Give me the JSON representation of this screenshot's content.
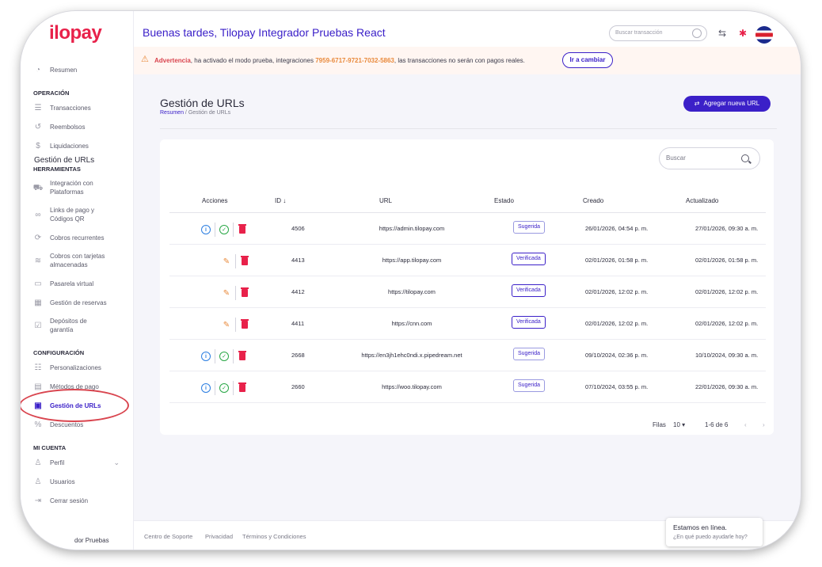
{
  "brand": {
    "logo_text": "tilopay",
    "accent": "#3b20c8",
    "brand_red": "#e8214a"
  },
  "header": {
    "greeting": "Buenas tardes, Tilopay Integrador Pruebas React",
    "search_placeholder": "Buscar transacción",
    "icons": [
      "swap-icon",
      "sparkle-icon",
      "flag-icon"
    ]
  },
  "warning": {
    "label": "Advertencia",
    "text_before": ", ha activado el modo prueba, integraciones ",
    "code": "7959-6717-9721-7032-5863",
    "text_after": ", las transacciones no serán con pagos reales.",
    "button": "Ir a cambiar"
  },
  "sidebar": {
    "top_item": "Resumen",
    "sections": [
      {
        "title": "OPERACIÓN",
        "items": [
          "Transacciones",
          "Reembolsos",
          "Liquidaciones"
        ]
      },
      {
        "title": "HERRAMIENTAS",
        "items": [
          "Integración con Plataformas",
          "Links de pago y Códigos QR",
          "Cobros recurrentes",
          "Cobros con tarjetas almacenadas",
          "Pasarela virtual",
          "Gestión de reservas",
          "Depósitos de garantía"
        ]
      },
      {
        "title": "CONFIGURACIÓN",
        "items": [
          "Personalizaciones",
          "Métodos de pago",
          "Gestión de URLs",
          "Descuentos"
        ]
      },
      {
        "title": "MI CUENTA",
        "items": [
          "Perfil",
          "Usuarios",
          "Cerrar sesión"
        ]
      }
    ],
    "bottom_text": "dor Pruebas"
  },
  "page": {
    "title": "Gestión de URLs",
    "breadcrumb_home": "Resumen",
    "breadcrumb_sep": "/",
    "breadcrumb_current": "Gestión de URLs",
    "add_button": "Agregar nueva URL"
  },
  "card": {
    "title": "Gestión de URLs",
    "search_placeholder": "Buscar",
    "columns": [
      "Acciones",
      "ID ↓",
      "URL",
      "Estado",
      "Creado",
      "Actualizado"
    ],
    "rows": [
      {
        "id": "4506",
        "url": "https://admin.tilopay.com",
        "status": "Sugerida",
        "created": "26/01/2026, 04:54 p. m.",
        "updated": "27/01/2026, 09:30 a. m.",
        "actions": "suggested"
      },
      {
        "id": "4413",
        "url": "https://app.tilopay.com",
        "status": "Verificada",
        "created": "02/01/2026, 01:58 p. m.",
        "updated": "02/01/2026, 01:58 p. m.",
        "actions": "verified"
      },
      {
        "id": "4412",
        "url": "https://tilopay.com",
        "status": "Verificada",
        "created": "02/01/2026, 12:02 p. m.",
        "updated": "02/01/2026, 12:02 p. m.",
        "actions": "verified"
      },
      {
        "id": "4411",
        "url": "https://cnn.com",
        "status": "Verificada",
        "created": "02/01/2026, 12:02 p. m.",
        "updated": "02/01/2026, 12:02 p. m.",
        "actions": "verified"
      },
      {
        "id": "2668",
        "url": "https://en3jh1ehc0ndi.x.pipedream.net",
        "status": "Sugerida",
        "created": "09/10/2024, 02:36 p. m.",
        "updated": "10/10/2024, 09:30 a. m.",
        "actions": "suggested"
      },
      {
        "id": "2660",
        "url": "https://woo.tilopay.com",
        "status": "Sugerida",
        "created": "07/10/2024, 03:55 p. m.",
        "updated": "22/01/2026, 09:30 a. m.",
        "actions": "suggested"
      }
    ],
    "pager": {
      "rows_label": "Filas",
      "rows_value": "10",
      "range": "1-6 de 6"
    }
  },
  "footer": {
    "links": [
      "Centro de Soporte",
      "Privacidad",
      "Términos y Condiciones"
    ]
  },
  "chat": {
    "title": "Estamos en línea.",
    "subtitle": "¿En qué puedo ayudarle hoy?"
  }
}
